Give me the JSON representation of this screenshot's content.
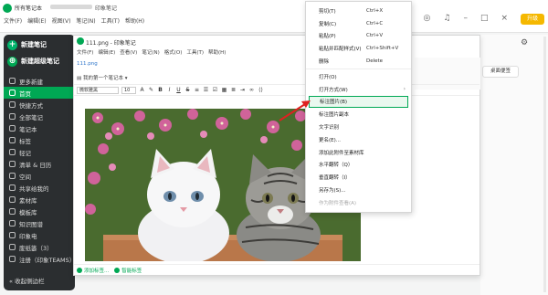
{
  "app": {
    "title": "所有笔记本",
    "title2": "印象笔记",
    "menu": [
      "文件(F)",
      "编辑(E)",
      "视图(V)",
      "笔记(N)",
      "工具(T)",
      "帮助(H)"
    ],
    "upgrade_label": "升级"
  },
  "sidebar": {
    "new_note": "新建笔记",
    "new_super_note": "新建超级笔记",
    "items": [
      {
        "label": "更多新建"
      },
      {
        "label": "首页"
      },
      {
        "label": "快捷方式"
      },
      {
        "label": "全部笔记"
      },
      {
        "label": "笔记本"
      },
      {
        "label": "标签"
      },
      {
        "label": "轻记"
      },
      {
        "label": "清单 & 日历"
      },
      {
        "label": "空间"
      },
      {
        "label": "共享给我的"
      },
      {
        "label": "素材库"
      },
      {
        "label": "模板库"
      },
      {
        "label": "知识图谱"
      },
      {
        "label": "印象电"
      },
      {
        "label": "废纸篓（3）"
      },
      {
        "label": "注册（印象TEAMS）"
      }
    ],
    "collapse_label": "收起侧边栏"
  },
  "note_window": {
    "title": "111.png - 印象笔记",
    "menu": [
      "文件(F)",
      "编辑(E)",
      "查看(V)",
      "笔记(N)",
      "格式(O)",
      "工具(T)",
      "帮助(H)"
    ],
    "file_label": "111.png",
    "notebook": "我的第一个笔记本",
    "font_name": "微软雅黑",
    "font_size": "10",
    "footer_add_tag": "添加标签...",
    "footer_smart_tag": "智能标签"
  },
  "right_panel": {
    "desktop_note": "桌面便签"
  },
  "context_menu": {
    "items": [
      {
        "label": "剪切(T)",
        "shortcut": "Ctrl+X"
      },
      {
        "label": "复制(C)",
        "shortcut": "Ctrl+C"
      },
      {
        "label": "粘贴(P)",
        "shortcut": "Ctrl+V"
      },
      {
        "label": "粘贴并匹配样式(V)",
        "shortcut": "Ctrl+Shift+V"
      },
      {
        "label": "删除",
        "shortcut": "Delete"
      },
      {
        "label": "打开(O)",
        "shortcut": ""
      },
      {
        "label": "打开方式(W)",
        "shortcut": ""
      },
      {
        "label": "标注图片(B)",
        "shortcut": ""
      },
      {
        "label": "标注图片副本",
        "shortcut": ""
      },
      {
        "label": "文字识别",
        "shortcut": ""
      },
      {
        "label": "更名(E)...",
        "shortcut": ""
      },
      {
        "label": "添加此附件至素材库",
        "shortcut": ""
      },
      {
        "label": "水平翻转（Q）",
        "shortcut": ""
      },
      {
        "label": "垂直翻转（I）",
        "shortcut": ""
      },
      {
        "label": "另存为(S)...",
        "shortcut": ""
      },
      {
        "label": "作为附件查看(A)",
        "shortcut": ""
      }
    ]
  },
  "colors": {
    "accent": "#00a854",
    "sidebar_bg": "#2b2e30",
    "upgrade": "#f5b800",
    "annotation": "#e02020"
  }
}
